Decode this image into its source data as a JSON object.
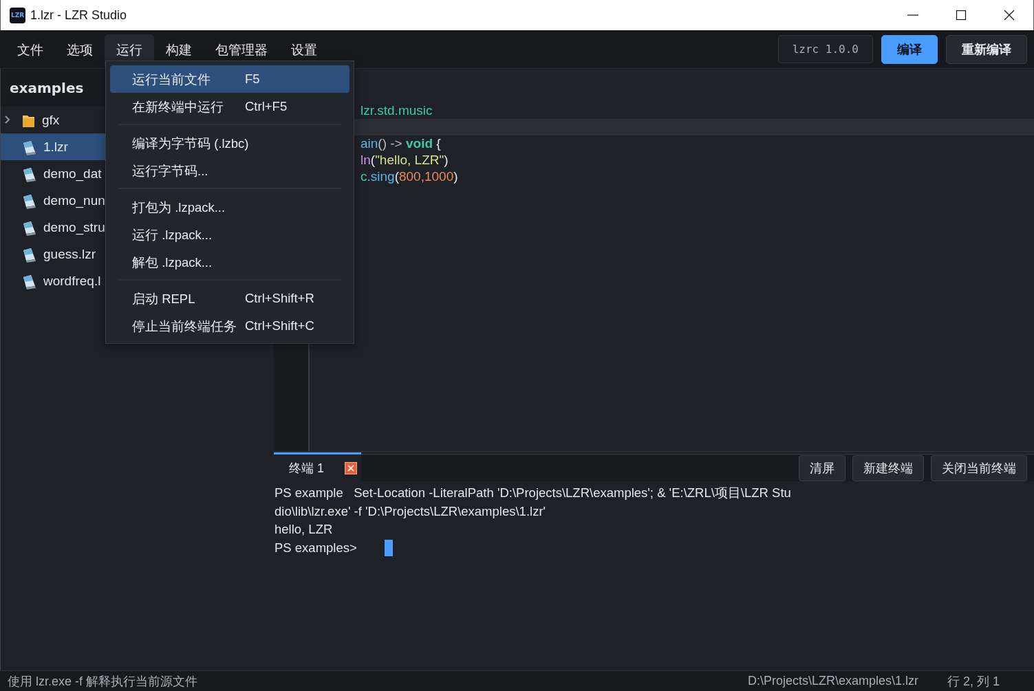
{
  "window": {
    "logo_text": "LZR",
    "title": "1.lzr - LZR Studio"
  },
  "menu_bar": [
    {
      "label": "文件",
      "selected": false
    },
    {
      "label": "选项",
      "selected": false
    },
    {
      "label": "运行",
      "selected": true
    },
    {
      "label": "构建",
      "selected": false
    },
    {
      "label": "包管理器",
      "selected": false
    },
    {
      "label": "设置",
      "selected": false
    }
  ],
  "toolbar": {
    "version": "lzrc 1.0.0",
    "buttons": [
      {
        "label": "编译",
        "kind": "primary"
      },
      {
        "label": "重新编译",
        "kind": "secondary"
      }
    ]
  },
  "sidebar": {
    "title": "examples",
    "items": [
      {
        "label": "gfx",
        "kind": "folder",
        "expanded": false,
        "selected": false
      },
      {
        "label": "1.lzr",
        "kind": "file",
        "selected": true
      },
      {
        "label": "demo_dat",
        "kind": "file",
        "selected": false
      },
      {
        "label": "demo_nun",
        "kind": "file",
        "selected": false
      },
      {
        "label": "demo_stru",
        "kind": "file",
        "selected": false
      },
      {
        "label": "guess.lzr",
        "kind": "file",
        "selected": false
      },
      {
        "label": "wordfreq.l",
        "kind": "file",
        "selected": false
      }
    ]
  },
  "run_menu": {
    "groups": [
      [
        {
          "label": "运行当前文件",
          "shortcut": "F5",
          "selected": true
        },
        {
          "label": "在新终端中运行",
          "shortcut": "Ctrl+F5",
          "selected": false
        }
      ],
      [
        {
          "label": "编译为字节码 (.lzbc)",
          "selected": false
        },
        {
          "label": "运行字节码...",
          "selected": false
        }
      ],
      [
        {
          "label": "打包为 .lzpack...",
          "selected": false
        },
        {
          "label": "运行 .lzpack...",
          "selected": false
        },
        {
          "label": "解包 .lzpack...",
          "selected": false
        }
      ],
      [
        {
          "label": "启动 REPL",
          "shortcut": "Ctrl+Shift+R",
          "selected": false
        },
        {
          "label": "停止当前终端任务",
          "shortcut": "Ctrl+Shift+C",
          "selected": false
        }
      ]
    ]
  },
  "editor": {
    "lines": [
      {
        "current": false,
        "tokens": [
          {
            "text": "lzr.std.music",
            "kind": "module"
          }
        ]
      },
      {
        "current": true
      },
      {
        "current": false,
        "tokens": [
          {
            "text": "ain",
            "kind": "func"
          },
          {
            "text": "() -> ",
            "kind": "punct"
          },
          {
            "text": "void",
            "kind": "keyword"
          },
          {
            "text": " {",
            "kind": "plain"
          }
        ]
      },
      {
        "current": false,
        "tokens": [
          {
            "text": "ln",
            "kind": "call"
          },
          {
            "text": "(",
            "kind": "plain"
          },
          {
            "text": "\"hello, LZR\"",
            "kind": "string"
          },
          {
            "text": ")",
            "kind": "plain"
          }
        ]
      },
      {
        "current": false,
        "tokens": [
          {
            "text": "c",
            "kind": "module"
          },
          {
            "text": ".sing",
            "kind": "func"
          },
          {
            "text": "(",
            "kind": "plain"
          },
          {
            "text": "800,1000",
            "kind": "number"
          },
          {
            "text": ")",
            "kind": "plain"
          }
        ]
      }
    ]
  },
  "terminal": {
    "tabs": [
      {
        "label": "终端 1",
        "selected": true
      }
    ],
    "buttons": [
      "清屏",
      "新建终端",
      "关闭当前终端"
    ],
    "lines": [
      "PS example   Set-Location -LiteralPath 'D:\\Projects\\LZR\\examples'; & 'E:\\ZRL\\项目\\LZR Stu",
      "dio\\lib\\lzr.exe' -f 'D:\\Projects\\LZR\\examples\\1.lzr'",
      "hello, LZR"
    ],
    "prompt": "PS examples>"
  },
  "status_bar": {
    "message": "使用 lzr.exe -f 解释执行当前源文件",
    "path": "D:\\Projects\\LZR\\examples\\1.lzr",
    "position": "行 2, 列 1"
  }
}
